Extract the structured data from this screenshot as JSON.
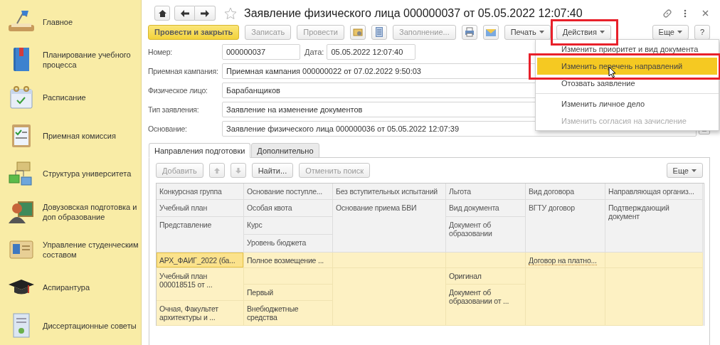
{
  "sidebar": {
    "items": [
      {
        "label": "Главное"
      },
      {
        "label": "Планирование учебного процесса"
      },
      {
        "label": "Расписание"
      },
      {
        "label": "Приемная комиссия"
      },
      {
        "label": "Структура университета"
      },
      {
        "label": "Довузовская подготовка и доп образование"
      },
      {
        "label": "Управление студенческим составом"
      },
      {
        "label": "Аспирантура"
      },
      {
        "label": "Диссертационные советы"
      }
    ]
  },
  "window": {
    "title": "Заявление физического лица 000000037 от 05.05.2022 12:07:40"
  },
  "toolbar": [
    {
      "kind": "primary",
      "label": "Провести и закрыть",
      "disabled": false,
      "outlined": false
    },
    {
      "kind": "button",
      "label": "Записать",
      "disabled": true,
      "outlined": false
    },
    {
      "kind": "button",
      "label": "Провести",
      "disabled": true,
      "outlined": false
    },
    {
      "kind": "icon",
      "disabled": false,
      "outlined": false
    },
    {
      "kind": "icon",
      "disabled": false,
      "outlined": false
    },
    {
      "kind": "button",
      "label": "Заполнение...",
      "disabled": true,
      "outlined": false
    },
    {
      "kind": "icon",
      "disabled": false,
      "outlined": false
    },
    {
      "kind": "icon",
      "disabled": false,
      "outlined": false
    },
    {
      "kind": "dropdown",
      "label": "Печать",
      "disabled": false,
      "outlined": false
    },
    {
      "kind": "dropdown",
      "label": "Действия",
      "disabled": false,
      "outlined": true
    },
    {
      "kind": "spacer"
    },
    {
      "kind": "dropdown",
      "label": "Еще",
      "disabled": false,
      "outlined": false
    },
    {
      "kind": "button",
      "label": "?",
      "disabled": false,
      "outlined": false
    }
  ],
  "form": {
    "rows": [
      [
        {
          "kind": "text",
          "label": "Номер:",
          "value": "000000037"
        },
        {
          "kind": "text",
          "label": "Дата:",
          "value": "05.05.2022 12:07:40"
        }
      ],
      [
        {
          "kind": "text",
          "label": "Приемная кампания:",
          "value": "Приемная кампания 000000022 от 07.02.2022 9:50:03"
        }
      ],
      [
        {
          "kind": "text",
          "label": "Физическое лицо:",
          "value": "Барабанщиков"
        }
      ],
      [
        {
          "kind": "text",
          "label": "Тип заявления:",
          "value": "Заявление на изменение документов"
        }
      ],
      [
        {
          "kind": "reference",
          "label": "Основание:",
          "value": "Заявление физического лица 000000036 от 05.05.2022 12:07:39"
        }
      ]
    ]
  },
  "tabs": [
    {
      "label": "Направления подготовки",
      "selected": true
    },
    {
      "label": "Дополнительно",
      "selected": false
    }
  ],
  "panel_toolbar": [
    {
      "kind": "button",
      "label": "Добавить",
      "disabled": true
    },
    {
      "kind": "up",
      "disabled": true
    },
    {
      "kind": "down",
      "disabled": true
    },
    {
      "kind": "button",
      "label": "Найти...",
      "disabled": false
    },
    {
      "kind": "button",
      "label": "Отменить поиск",
      "disabled": true
    },
    {
      "kind": "spacer"
    },
    {
      "kind": "dropdown",
      "label": "Еще",
      "disabled": false
    }
  ],
  "table": {
    "header_columns": [
      [
        "Конкурсная группа",
        "Учебный план",
        "Представление"
      ],
      [
        "Основание поступле...",
        "Особая квота",
        "Курс",
        "Уровень бюджета"
      ],
      [
        "Без вступительных испытаний",
        "Основание приема БВИ"
      ],
      [
        "Льгота",
        "Вид документа",
        "Документ об образовании"
      ],
      [
        "Вид договора",
        "ВГТУ договор"
      ],
      [
        "Направляющая организ...",
        "Подтверждающий документ"
      ]
    ],
    "rows": [
      {
        "selected": true,
        "cells": [
          {
            "kind": "text",
            "text": "АРХ_ФАИГ_2022 (ба...",
            "selected": true
          },
          {
            "kind": "text",
            "text": "Учебный план 000018515 от ...",
            "selected": false
          },
          {
            "kind": "text",
            "text": "Очная, Факультет архитектуры и ...",
            "selected": false
          },
          {
            "kind": "text",
            "text": "Полное возмещение ...",
            "selected": false
          },
          {
            "kind": "text",
            "text": "Первый",
            "selected": false
          },
          {
            "kind": "text",
            "text": "Внебюджетные средства",
            "selected": false
          },
          {
            "kind": "text",
            "text": "Оригинал",
            "selected": false
          },
          {
            "kind": "text",
            "text": "Документ об образовании от ...",
            "selected": false
          },
          {
            "kind": "link",
            "text": "Договор на платно...",
            "selected": false
          }
        ]
      }
    ]
  },
  "menu": {
    "groups": [
      [
        {
          "label": "Изменить приоритет и вид документа",
          "selected": false,
          "disabled": false,
          "outlined": false
        },
        {
          "label": "Изменить перечень направлений",
          "selected": true,
          "disabled": false,
          "outlined": true
        },
        {
          "label": "Отозвать заявление",
          "selected": false,
          "disabled": false,
          "outlined": false
        }
      ],
      [
        {
          "label": "Изменить личное дело",
          "selected": false,
          "disabled": false,
          "outlined": false
        },
        {
          "label": "Изменить согласия на зачисление",
          "selected": false,
          "disabled": true,
          "outlined": false
        }
      ]
    ]
  }
}
